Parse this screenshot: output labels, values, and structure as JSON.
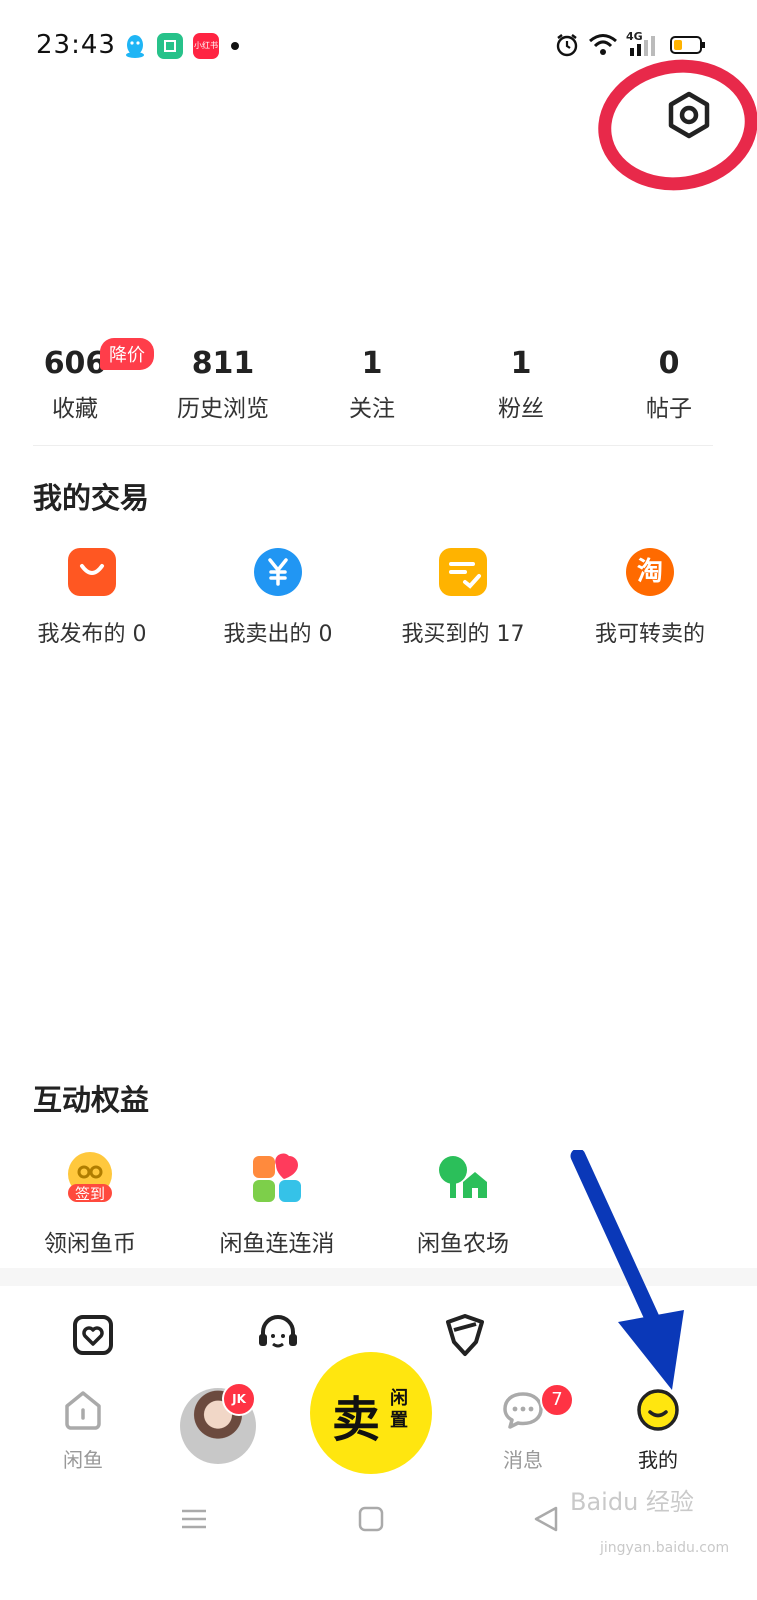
{
  "status_bar": {
    "time": "23:43",
    "xhs_label": "小红书",
    "network": "4G"
  },
  "stats": [
    {
      "value": "606",
      "label": "收藏"
    },
    {
      "value": "811",
      "label": "历史浏览"
    },
    {
      "value": "1",
      "label": "关注"
    },
    {
      "value": "1",
      "label": "粉丝"
    },
    {
      "value": "0",
      "label": "帖子"
    }
  ],
  "price_drop_badge": "降价",
  "trade": {
    "title": "我的交易",
    "items": [
      {
        "label": "我发布的 0",
        "icon": "shopping-bag-icon",
        "color": "#ff5722"
      },
      {
        "label": "我卖出的 0",
        "icon": "yuan-icon",
        "color": "#2196f3"
      },
      {
        "label": "我买到的 17",
        "icon": "list-check-icon",
        "color": "#ffb300"
      },
      {
        "label": "我可转卖的",
        "icon": "taobao-icon",
        "color": "#ff6a00",
        "glyph": "淘"
      }
    ]
  },
  "benefits": {
    "title": "互动权益",
    "items": [
      {
        "label": "领闲鱼币",
        "icon": "sign-in-icon",
        "tag": "签到"
      },
      {
        "label": "闲鱼连连消",
        "icon": "puzzle-icon"
      },
      {
        "label": "闲鱼农场",
        "icon": "farm-icon"
      }
    ]
  },
  "bottom_nav": {
    "home_label": "闲鱼",
    "avatar_badge": "JK",
    "sell_main": "卖",
    "sell_sub": "闲置",
    "messages_label": "消息",
    "messages_count": "7",
    "mine_label": "我的"
  },
  "watermark": {
    "text": "Baidu 经验",
    "url": "jingyan.baidu.com"
  },
  "colors": {
    "accent_yellow": "#ffe60f",
    "badge_red": "#ff3344",
    "annotation_red": "#e8294a",
    "annotation_blue": "#0a38b8"
  }
}
